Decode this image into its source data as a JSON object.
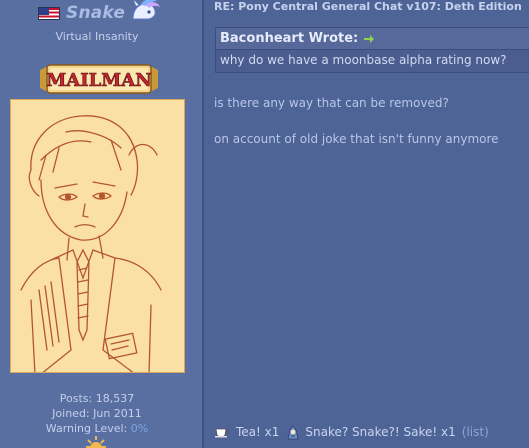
{
  "user": {
    "flag_icon": "us-flag-icon",
    "name": "Snake",
    "badge_icon": "pony-icon",
    "custom_title": "Virtual Insanity",
    "rank_banner": "MAILMAN",
    "stats": {
      "posts": "Posts: 18,537",
      "joined": "Joined: Jun 2011",
      "warning_label": "Warning Level: ",
      "warning_value": "0%"
    }
  },
  "post": {
    "title": "RE: Pony Central General Chat v107: Deth Edition",
    "quote": {
      "author": "Baconheart Wrote:",
      "arrow_icon": "green-arrow-icon",
      "text": "why do we have a moonbase alpha rating now?"
    },
    "lines": [
      "is there any way that can be removed?",
      "on account of old joke that isn't funny anymore"
    ],
    "reputation": {
      "item1_icon": "teacup-icon",
      "item1_text": "Tea! x1",
      "item2_icon": "pony-icon",
      "item2_text": "Snake? Snake?! Sake! x1",
      "list_link": "(list)"
    }
  },
  "colors": {
    "background": "#4f6496",
    "sidebar": "#5a6fa1",
    "avatar_bg": "#fbe0a6",
    "link": "#8ea5d8"
  }
}
